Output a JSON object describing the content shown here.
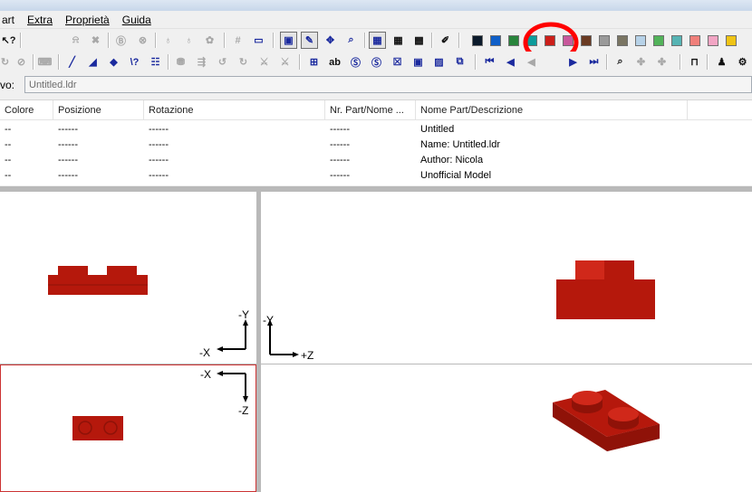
{
  "menu": {
    "items": [
      {
        "label": "art"
      },
      {
        "label": "Extra"
      },
      {
        "label": "Proprietà"
      },
      {
        "label": "Guida"
      }
    ]
  },
  "toolbar_colors": {
    "palette": [
      "#0b1a2b",
      "#0f5fc8",
      "#28843c",
      "#0e9c9c",
      "#cc1f1a",
      "#c8589c",
      "#6a3a22",
      "#9a9a9a",
      "#7a7563",
      "#b7d2e8",
      "#52b35a",
      "#56b4b4",
      "#f07f7a",
      "#f2a5c4",
      "#f0c415"
    ],
    "selected_color": "#cc1f1a",
    "highlight_color": "#ff0000"
  },
  "file_row": {
    "label": "vo:",
    "value": "Untitled.ldr"
  },
  "parts_list": {
    "columns": [
      "Colore",
      "Posizione",
      "Rotazione",
      "Nr. Part/Nome ...",
      "Nome Part/Descrizione"
    ],
    "rows": [
      [
        "--",
        "------",
        "------",
        "------",
        "Untitled"
      ],
      [
        "--",
        "------",
        "------",
        "------",
        "Name: Untitled.ldr"
      ],
      [
        "--",
        "------",
        "------",
        "------",
        "Author: Nicola"
      ],
      [
        "--",
        "------",
        "------",
        "------",
        "Unofficial Model"
      ]
    ]
  },
  "views": {
    "brick_color": "#b5180c",
    "brick_dark": "#8f1208",
    "brick_light": "#d0281a",
    "front": {
      "axis_up": "-Y",
      "axis_side": "-X"
    },
    "side": {
      "axis_up": "-Y",
      "axis_side": "+Z"
    },
    "top": {
      "axis_side": "-X",
      "axis_down": "-Z"
    }
  }
}
